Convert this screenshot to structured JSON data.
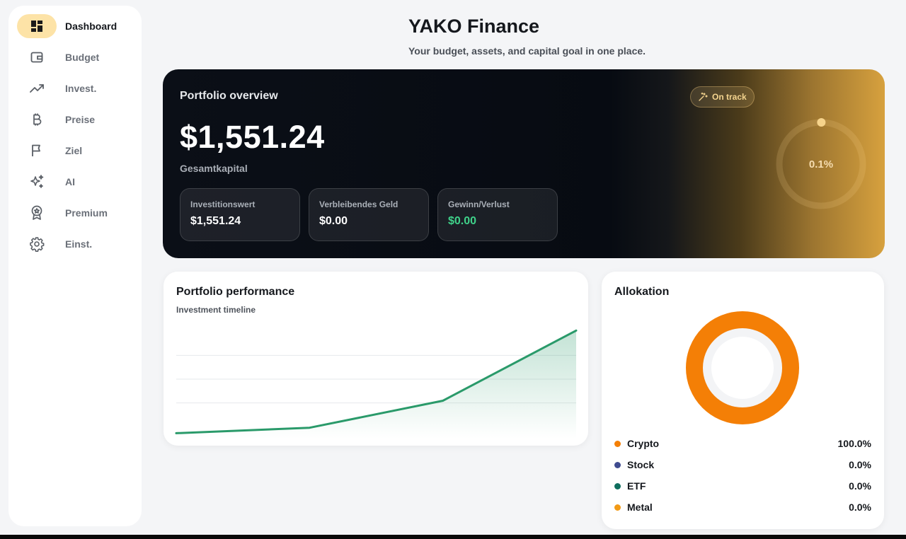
{
  "nav": {
    "items": [
      {
        "label": "Dashboard",
        "icon": "dashboard-icon",
        "active": true
      },
      {
        "label": "Budget",
        "icon": "wallet-icon"
      },
      {
        "label": "Invest.",
        "icon": "trending-up-icon"
      },
      {
        "label": "Preise",
        "icon": "bitcoin-icon"
      },
      {
        "label": "Ziel",
        "icon": "flag-icon"
      },
      {
        "label": "AI",
        "icon": "sparkles-icon"
      },
      {
        "label": "Premium",
        "icon": "award-icon"
      },
      {
        "label": "Einst.",
        "icon": "settings-icon"
      }
    ]
  },
  "header": {
    "title": "YAKO Finance",
    "subtitle": "Your budget, assets, and capital goal in one place."
  },
  "overview": {
    "title": "Portfolio overview",
    "total": "$1,551.24",
    "total_label": "Gesamtkapital",
    "badge": "On track",
    "goal_progress_label": "0.1%",
    "goal_progress": 0.001,
    "stats": [
      {
        "label": "Investitionswert",
        "value": "$1,551.24"
      },
      {
        "label": "Verbleibendes Geld",
        "value": "$0.00"
      },
      {
        "label": "Gewinn/Verlust",
        "value": "$0.00"
      }
    ]
  },
  "performance": {
    "title": "Portfolio performance",
    "subtitle": "Investment timeline"
  },
  "allocation": {
    "title": "Allokation",
    "items": [
      {
        "name": "Crypto",
        "value": "100.0%",
        "color": "#f47f06"
      },
      {
        "name": "Stock",
        "value": "0.0%",
        "color": "#3f4b8f"
      },
      {
        "name": "ETF",
        "value": "0.0%",
        "color": "#0f6e5e"
      },
      {
        "name": "Metal",
        "value": "0.0%",
        "color": "#f29a16"
      }
    ]
  },
  "colors": {
    "accent": "#fde3a7",
    "line": "#2a9a6a",
    "positive": "#3fd28a"
  },
  "chart_data": {
    "type": "area",
    "title": "Portfolio performance",
    "subtitle": "Investment timeline",
    "xlabel": "",
    "ylabel": "",
    "x": [
      1,
      2,
      3,
      4
    ],
    "values": [
      0.05,
      0.1,
      0.35,
      1.0
    ],
    "ylim": [
      0,
      1.1
    ],
    "grid": true,
    "legend": "none"
  }
}
